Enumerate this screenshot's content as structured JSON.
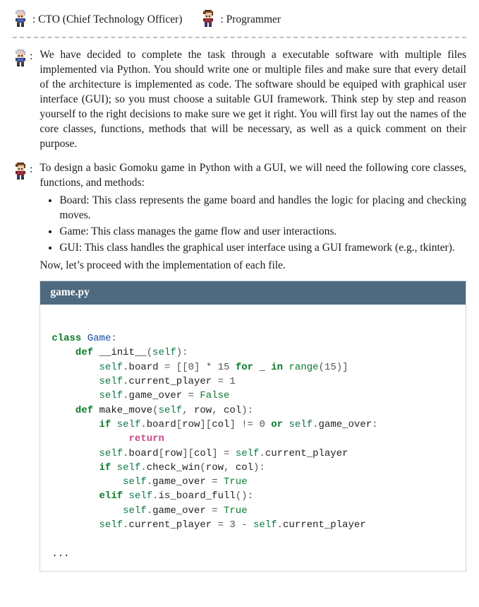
{
  "legend": {
    "cto_label": ": CTO (Chief Technology Officer)",
    "programmer_label": ": Programmer"
  },
  "messages": {
    "cto": {
      "text": "We have decided to complete the task through a executable software with multiple files implemented via Python. You should write one or multiple files and make sure that every detail of the architecture is implemented as code. The software should be equiped with graphical user interface (GUI); so you must choose a suitable GUI framework.  Think step by step and reason yourself to the right decisions to make sure we get it right. You will first lay out the names of the core classes, functions, methods that will be necessary, as well as a quick comment on their purpose."
    },
    "programmer": {
      "intro": "To design a basic Gomoku game in Python with a GUI, we will need the following core classes, functions, and methods:",
      "bullets": [
        "Board: This class represents the game board and handles the logic for placing and checking moves.",
        "Game: This class manages the game flow and user interactions.",
        "GUI: This class handles the graphical user interface using a GUI framework (e.g., tkinter)."
      ],
      "outro": "Now, let’s proceed with the implementation of each file."
    }
  },
  "code": {
    "filename": "game.py",
    "ellipsis": "...",
    "tokens": [
      [
        "nl",
        ""
      ],
      [
        "kw",
        "class"
      ],
      [
        "sp",
        " "
      ],
      [
        "cls",
        "Game"
      ],
      [
        "op",
        ":"
      ],
      [
        "nl",
        ""
      ],
      [
        "sp",
        "    "
      ],
      [
        "def",
        "def"
      ],
      [
        "sp",
        " "
      ],
      [
        "fn",
        "__init__"
      ],
      [
        "op",
        "("
      ],
      [
        "self",
        "self"
      ],
      [
        "op",
        "):"
      ],
      [
        "nl",
        ""
      ],
      [
        "sp",
        "        "
      ],
      [
        "self",
        "self"
      ],
      [
        "op",
        "."
      ],
      [
        "plain",
        "board"
      ],
      [
        "sp",
        " "
      ],
      [
        "op",
        "="
      ],
      [
        "sp",
        " "
      ],
      [
        "op",
        "[["
      ],
      [
        "num",
        "0"
      ],
      [
        "op",
        "]"
      ],
      [
        "sp",
        " "
      ],
      [
        "op",
        "*"
      ],
      [
        "sp",
        " "
      ],
      [
        "num",
        "15"
      ],
      [
        "sp",
        " "
      ],
      [
        "kw",
        "for"
      ],
      [
        "sp",
        " "
      ],
      [
        "plain",
        "_"
      ],
      [
        "sp",
        " "
      ],
      [
        "kw",
        "in"
      ],
      [
        "sp",
        " "
      ],
      [
        "builtin",
        "range"
      ],
      [
        "op",
        "("
      ],
      [
        "num",
        "15"
      ],
      [
        "op",
        ")]"
      ],
      [
        "nl",
        ""
      ],
      [
        "sp",
        "        "
      ],
      [
        "self",
        "self"
      ],
      [
        "op",
        "."
      ],
      [
        "plain",
        "current_player"
      ],
      [
        "sp",
        " "
      ],
      [
        "op",
        "="
      ],
      [
        "sp",
        " "
      ],
      [
        "num",
        "1"
      ],
      [
        "nl",
        ""
      ],
      [
        "sp",
        "        "
      ],
      [
        "self",
        "self"
      ],
      [
        "op",
        "."
      ],
      [
        "plain",
        "game_over"
      ],
      [
        "sp",
        " "
      ],
      [
        "op",
        "="
      ],
      [
        "sp",
        " "
      ],
      [
        "bool",
        "False"
      ],
      [
        "nl",
        ""
      ],
      [
        "sp",
        "    "
      ],
      [
        "def",
        "def"
      ],
      [
        "sp",
        " "
      ],
      [
        "fn",
        "make_move"
      ],
      [
        "op",
        "("
      ],
      [
        "self",
        "self"
      ],
      [
        "op",
        ","
      ],
      [
        "sp",
        " "
      ],
      [
        "plain",
        "row"
      ],
      [
        "op",
        ","
      ],
      [
        "sp",
        " "
      ],
      [
        "plain",
        "col"
      ],
      [
        "op",
        "):"
      ],
      [
        "nl",
        ""
      ],
      [
        "sp",
        "        "
      ],
      [
        "kw",
        "if"
      ],
      [
        "sp",
        " "
      ],
      [
        "self",
        "self"
      ],
      [
        "op",
        "."
      ],
      [
        "plain",
        "board"
      ],
      [
        "op",
        "["
      ],
      [
        "plain",
        "row"
      ],
      [
        "op",
        "]["
      ],
      [
        "plain",
        "col"
      ],
      [
        "op",
        "]"
      ],
      [
        "sp",
        " "
      ],
      [
        "op",
        "!="
      ],
      [
        "sp",
        " "
      ],
      [
        "num",
        "0"
      ],
      [
        "sp",
        " "
      ],
      [
        "kw",
        "or"
      ],
      [
        "sp",
        " "
      ],
      [
        "self",
        "self"
      ],
      [
        "op",
        "."
      ],
      [
        "plain",
        "game_over"
      ],
      [
        "op",
        ":"
      ],
      [
        "nl",
        ""
      ],
      [
        "sp",
        "             "
      ],
      [
        "ret",
        "return"
      ],
      [
        "nl",
        ""
      ],
      [
        "sp",
        "        "
      ],
      [
        "self",
        "self"
      ],
      [
        "op",
        "."
      ],
      [
        "plain",
        "board"
      ],
      [
        "op",
        "["
      ],
      [
        "plain",
        "row"
      ],
      [
        "op",
        "]["
      ],
      [
        "plain",
        "col"
      ],
      [
        "op",
        "]"
      ],
      [
        "sp",
        " "
      ],
      [
        "op",
        "="
      ],
      [
        "sp",
        " "
      ],
      [
        "self",
        "self"
      ],
      [
        "op",
        "."
      ],
      [
        "plain",
        "current_player"
      ],
      [
        "nl",
        ""
      ],
      [
        "sp",
        "        "
      ],
      [
        "kw",
        "if"
      ],
      [
        "sp",
        " "
      ],
      [
        "self",
        "self"
      ],
      [
        "op",
        "."
      ],
      [
        "plain",
        "check_win"
      ],
      [
        "op",
        "("
      ],
      [
        "plain",
        "row"
      ],
      [
        "op",
        ","
      ],
      [
        "sp",
        " "
      ],
      [
        "plain",
        "col"
      ],
      [
        "op",
        "):"
      ],
      [
        "nl",
        ""
      ],
      [
        "sp",
        "            "
      ],
      [
        "self",
        "self"
      ],
      [
        "op",
        "."
      ],
      [
        "plain",
        "game_over"
      ],
      [
        "sp",
        " "
      ],
      [
        "op",
        "="
      ],
      [
        "sp",
        " "
      ],
      [
        "bool",
        "True"
      ],
      [
        "nl",
        ""
      ],
      [
        "sp",
        "        "
      ],
      [
        "kw",
        "elif"
      ],
      [
        "sp",
        " "
      ],
      [
        "self",
        "self"
      ],
      [
        "op",
        "."
      ],
      [
        "plain",
        "is_board_full"
      ],
      [
        "op",
        "():"
      ],
      [
        "nl",
        ""
      ],
      [
        "sp",
        "            "
      ],
      [
        "self",
        "self"
      ],
      [
        "op",
        "."
      ],
      [
        "plain",
        "game_over"
      ],
      [
        "sp",
        " "
      ],
      [
        "op",
        "="
      ],
      [
        "sp",
        " "
      ],
      [
        "bool",
        "True"
      ],
      [
        "nl",
        ""
      ],
      [
        "sp",
        "        "
      ],
      [
        "self",
        "self"
      ],
      [
        "op",
        "."
      ],
      [
        "plain",
        "current_player"
      ],
      [
        "sp",
        " "
      ],
      [
        "op",
        "="
      ],
      [
        "sp",
        " "
      ],
      [
        "num",
        "3"
      ],
      [
        "sp",
        " "
      ],
      [
        "op",
        "-"
      ],
      [
        "sp",
        " "
      ],
      [
        "self",
        "self"
      ],
      [
        "op",
        "."
      ],
      [
        "plain",
        "current_player"
      ],
      [
        "nl",
        ""
      ]
    ]
  }
}
